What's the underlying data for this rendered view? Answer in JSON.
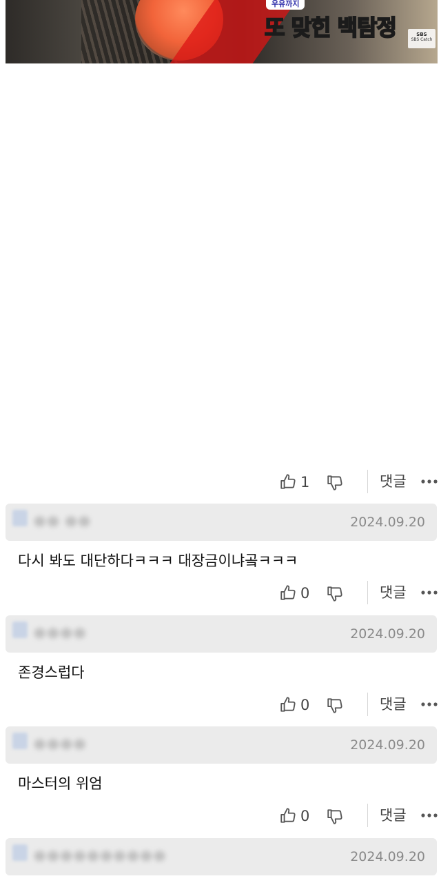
{
  "video": {
    "tag": "우유까지",
    "caption_part1": "또 맞힌 ",
    "caption_part2": "백탐정",
    "logo_top": "SBS",
    "logo_bottom": "SBS Catch"
  },
  "actions": {
    "reply_label": "댓글"
  },
  "post_bar": {
    "like_count": "1"
  },
  "comments": [
    {
      "username": "ㅇㅇ ㅇㅇ",
      "date": "2024.09.20",
      "text": "다시 봐도 대단하다ㅋㅋㅋ 대장금이냐곸ㅋㅋㅋ",
      "like_count": "0"
    },
    {
      "username": "ㅇㅇㅇㅇ",
      "date": "2024.09.20",
      "text": "존경스럽다",
      "like_count": "0"
    },
    {
      "username": "ㅇㅇㅇㅇ",
      "date": "2024.09.20",
      "text": "마스터의 위엄",
      "like_count": "0"
    },
    {
      "username": "ㅇㅇㅇㅇㅇㅇㅇㅇㅇㅇ",
      "date": "2024.09.20"
    }
  ],
  "icons": {
    "like": "thumbs-up-icon",
    "dislike": "thumbs-down-icon",
    "more": "more-dots-icon"
  }
}
